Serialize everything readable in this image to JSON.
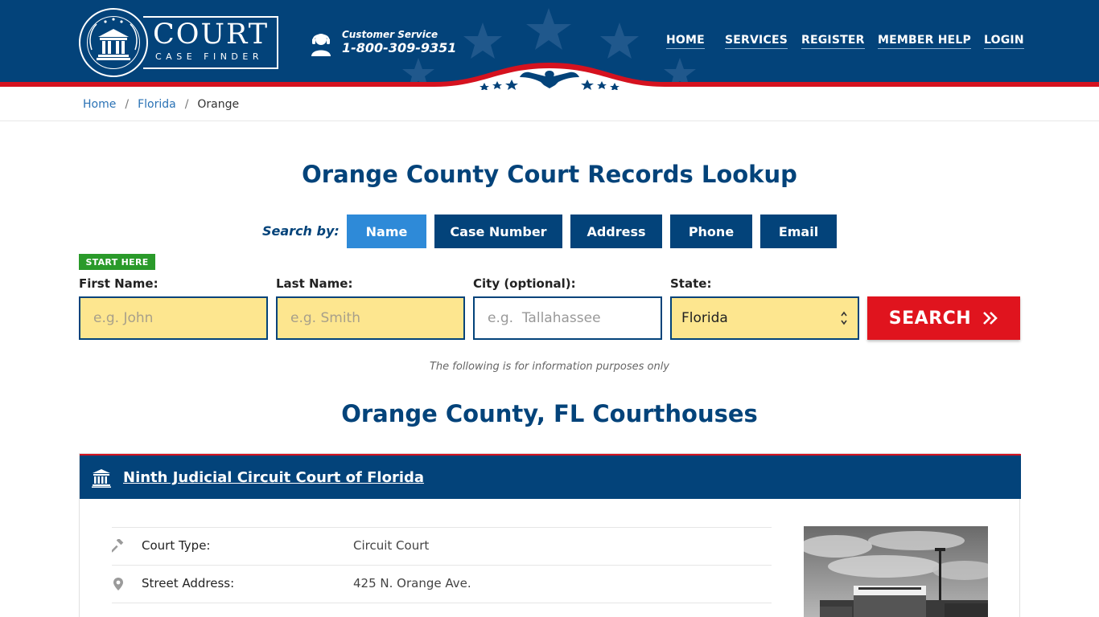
{
  "header": {
    "logo": {
      "title": "COURT",
      "subtitle": "CASE FINDER"
    },
    "customer_service": {
      "label": "Customer Service",
      "phone": "1-800-309-9351"
    },
    "nav": [
      "HOME",
      "SERVICES",
      "REGISTER",
      "MEMBER HELP",
      "LOGIN"
    ],
    "colors": {
      "primary": "#03437a",
      "accent_red": "#d5121f"
    }
  },
  "breadcrumb": [
    "Home",
    "Florida",
    "Orange"
  ],
  "page_title": "Orange County Court Records Lookup",
  "search": {
    "search_by_label": "Search by:",
    "tabs": [
      "Name",
      "Case Number",
      "Address",
      "Phone",
      "Email"
    ],
    "active_tab": "Name",
    "start_here": "START HERE",
    "fields": {
      "first_name": {
        "label": "First Name:",
        "placeholder": "e.g. John"
      },
      "last_name": {
        "label": "Last Name:",
        "placeholder": "e.g. Smith"
      },
      "city": {
        "label": "City (optional):",
        "placeholder": "e.g.  Tallahassee"
      },
      "state": {
        "label": "State:",
        "value": "Florida"
      }
    },
    "button": "SEARCH",
    "note": "The following is for information purposes only"
  },
  "courthouses": {
    "title": "Orange County, FL Courthouses",
    "items": [
      {
        "name": "Ninth Judicial Circuit Court of Florida",
        "rows": [
          {
            "icon": "gavel-icon",
            "label": "Court Type:",
            "value": "Circuit Court"
          },
          {
            "icon": "map-pin-icon",
            "label": "Street Address:",
            "value": "425 N. Orange Ave."
          }
        ]
      }
    ]
  }
}
